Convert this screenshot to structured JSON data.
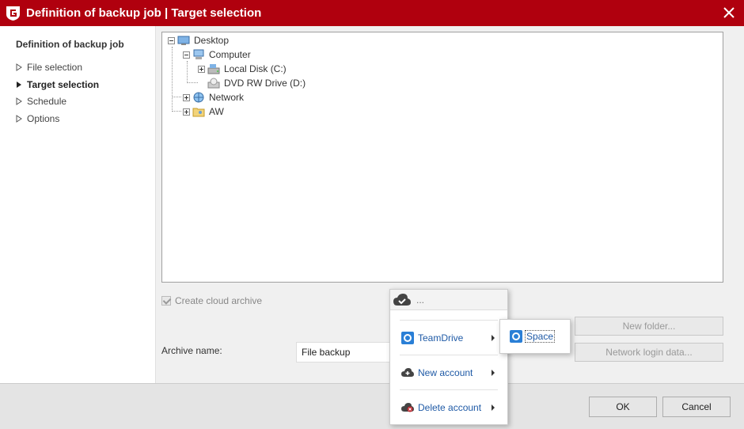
{
  "window": {
    "title": "Definition of backup job | Target selection"
  },
  "sidebar": {
    "heading": "Definition of backup job",
    "items": [
      {
        "label": "File selection",
        "active": false
      },
      {
        "label": "Target selection",
        "active": true
      },
      {
        "label": "Schedule",
        "active": false
      },
      {
        "label": "Options",
        "active": false
      }
    ]
  },
  "tree": {
    "nodes": [
      {
        "label": "Desktop",
        "icon": "desktop-icon"
      },
      {
        "label": "Computer",
        "icon": "computer-icon"
      },
      {
        "label": "Local Disk (C:)",
        "icon": "hard-disk-icon"
      },
      {
        "label": "DVD RW Drive (D:)",
        "icon": "dvd-drive-icon"
      },
      {
        "label": "Network",
        "icon": "network-icon"
      },
      {
        "label": "AW",
        "icon": "user-folder-icon"
      }
    ]
  },
  "cloud": {
    "checkbox_label": "Create cloud archive",
    "checked": true
  },
  "archive": {
    "label": "Archive name:",
    "value": "File backup"
  },
  "buttons": {
    "new_folder": "New folder...",
    "network_login": "Network login data...",
    "ok": "OK",
    "cancel": "Cancel"
  },
  "cloud_menu": {
    "header": "...",
    "items": [
      {
        "label": "TeamDrive",
        "icon": "teamdrive-icon"
      },
      {
        "label": "New account",
        "icon": "cloud-add-icon"
      },
      {
        "label": "Delete account",
        "icon": "cloud-delete-icon"
      }
    ],
    "submenu": {
      "label": "Space",
      "icon": "teamdrive-icon"
    }
  },
  "colors": {
    "titlebar": "#b0000e",
    "link": "#1f5aa6"
  }
}
